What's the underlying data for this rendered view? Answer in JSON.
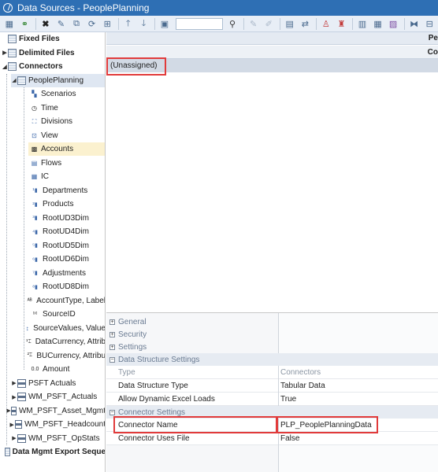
{
  "window": {
    "title": "Data Sources - PeoplePlanning"
  },
  "tree": {
    "items": [
      {
        "label": "Fixed Files",
        "bold": true,
        "arrow": "",
        "icon": "grid",
        "indent": 0
      },
      {
        "label": "Delimited Files",
        "bold": true,
        "arrow": "▶",
        "icon": "grid",
        "indent": 0
      },
      {
        "label": "Connectors",
        "bold": true,
        "arrow": "◢",
        "icon": "grid",
        "indent": 0
      },
      {
        "label": "PeoplePlanning",
        "bold": false,
        "arrow": "◢",
        "icon": "grid",
        "indent": 1,
        "selectedParent": true
      },
      {
        "label": "Scenarios",
        "icon": "scenarios",
        "indent": 2
      },
      {
        "label": "Time",
        "icon": "time",
        "indent": 2
      },
      {
        "label": "Divisions",
        "icon": "divisions",
        "indent": 2
      },
      {
        "label": "View",
        "icon": "view",
        "indent": 2
      },
      {
        "label": "Accounts",
        "icon": "accounts",
        "indent": 2,
        "selected": true
      },
      {
        "label": "Flows",
        "icon": "flows",
        "indent": 2
      },
      {
        "label": "IC",
        "icon": "ic",
        "indent": 2
      },
      {
        "label": "Departments",
        "icon": "ud1",
        "indent": 2
      },
      {
        "label": "Products",
        "icon": "ud2",
        "indent": 2
      },
      {
        "label": "RootUD3Dim",
        "icon": "ud3",
        "indent": 2
      },
      {
        "label": "RootUD4Dim",
        "icon": "ud4",
        "indent": 2
      },
      {
        "label": "RootUD5Dim",
        "icon": "ud5",
        "indent": 2
      },
      {
        "label": "RootUD6Dim",
        "icon": "ud6",
        "indent": 2
      },
      {
        "label": "Adjustments",
        "icon": "ud7",
        "indent": 2
      },
      {
        "label": "RootUD8Dim",
        "icon": "ud8",
        "indent": 2
      },
      {
        "label": "AccountType, Label",
        "icon": "label",
        "indent": 2
      },
      {
        "label": "SourceID",
        "icon": "txt",
        "indent": 2
      },
      {
        "label": "SourceValues, Value",
        "icon": "sv",
        "indent": 2
      },
      {
        "label": "DataCurrency, Attrib",
        "icon": "attr1",
        "indent": 2
      },
      {
        "label": "BUCurrency, Attribu",
        "icon": "attr2",
        "indent": 2
      },
      {
        "label": "Amount",
        "icon": "amount",
        "indent": 2
      },
      {
        "label": "PSFT Actuals",
        "arrow": "▶",
        "icon": "table",
        "indent": 1
      },
      {
        "label": "WM_PSFT_Actuals",
        "arrow": "▶",
        "icon": "table",
        "indent": 1
      },
      {
        "label": "WM_PSFT_Asset_Mgmt",
        "arrow": "▶",
        "icon": "table",
        "indent": 1
      },
      {
        "label": "WM_PSFT_Headcount",
        "arrow": "▶",
        "icon": "table",
        "indent": 1
      },
      {
        "label": "WM_PSFT_OpStats",
        "arrow": "▶",
        "icon": "table",
        "indent": 1
      },
      {
        "label": "Data Mgmt Export Seque",
        "bold": true,
        "arrow": "",
        "icon": "grid",
        "indent": 0
      }
    ]
  },
  "main": {
    "header_top": "Pe",
    "header_second": "Co",
    "unassigned": "(Unassigned)"
  },
  "props": {
    "categories": {
      "general": "General",
      "security": "Security",
      "settings": "Settings",
      "data_structure_settings": "Data Structure Settings",
      "connector_settings": "Connector Settings"
    },
    "rows": {
      "type_key": "Type",
      "type_val": "Connectors",
      "dst_key": "Data Structure Type",
      "dst_val": "Tabular Data",
      "ade_key": "Allow Dynamic Excel Loads",
      "ade_val": "True",
      "cn_key": "Connector Name",
      "cn_val": "PLP_PeoplePlanningData",
      "cuf_key": "Connector Uses File",
      "cuf_val": "False"
    }
  },
  "colors": {
    "titlebar": "#2e6fb4",
    "highlight": "#e13b3b",
    "selection": "#fbf1cf"
  }
}
